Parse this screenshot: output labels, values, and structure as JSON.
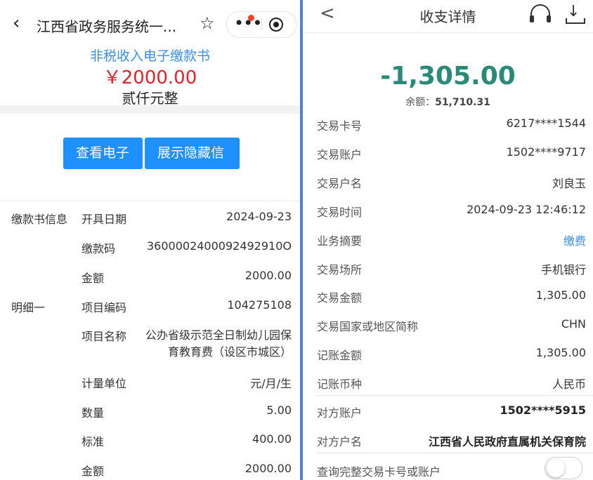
{
  "left": {
    "header": {
      "back_icon": "‹",
      "title": "江西省政务服务统一...",
      "star_icon": "☆",
      "more_icon": "•••"
    },
    "doc_title": "非税收入电子缴款书",
    "amount": "￥2000.00",
    "amount_cn": "贰仟元整",
    "buttons": {
      "view": "查看电子",
      "show_hidden": "展示隐藏信"
    },
    "rows": [
      {
        "section": "缴款书信息",
        "label": "开具日期",
        "value": "2024-09-23"
      },
      {
        "section": "",
        "label": "缴款码",
        "value": "3600002400092492910O"
      },
      {
        "section": "",
        "label": "金额",
        "value": "2000.00"
      },
      {
        "section": "明细一",
        "label": "项目编码",
        "value": "104275108"
      },
      {
        "section": "",
        "label": "项目名称",
        "value": "公办省级示范全日制幼儿园保育教育费（设区市城区）"
      },
      {
        "section": "",
        "label": "计量单位",
        "value": "元/月/生"
      },
      {
        "section": "",
        "label": "数量",
        "value": "5.00"
      },
      {
        "section": "",
        "label": "标准",
        "value": "400.00"
      },
      {
        "section": "",
        "label": "金额",
        "value": "2000.00"
      }
    ]
  },
  "right": {
    "header": {
      "back_icon": "<",
      "title": "收支详情",
      "support_icon": "headset-icon",
      "download_icon": "download-icon"
    },
    "amount": "-1,305.00",
    "balance_label": "余额：",
    "balance_value": "51,710.31",
    "rows": [
      {
        "label": "交易卡号",
        "value": "6217****1544"
      },
      {
        "label": "交易账户",
        "value": "1502****9717"
      },
      {
        "label": "交易户名",
        "value": "刘良玉"
      },
      {
        "label": "交易时间",
        "value": "2024-09-23 12:46:12"
      },
      {
        "label": "业务摘要",
        "value": "缴费"
      },
      {
        "label": "交易场所",
        "value": "手机银行"
      },
      {
        "label": "交易金额",
        "value": "1,305.00"
      },
      {
        "label": "交易国家或地区简称",
        "value": "CHN"
      },
      {
        "label": "记账金额",
        "value": "1,305.00"
      },
      {
        "label": "记账币种",
        "value": "人民币"
      },
      {
        "label": "对方账户",
        "value": "1502****5915"
      },
      {
        "label": "对方户名",
        "value": "江西省人民政府直属机关保育院"
      },
      {
        "label": "查询完整交易卡号或账户",
        "value": ""
      }
    ],
    "colors": {
      "amount": "#2a8a78",
      "link": "#3a8fe8"
    }
  }
}
